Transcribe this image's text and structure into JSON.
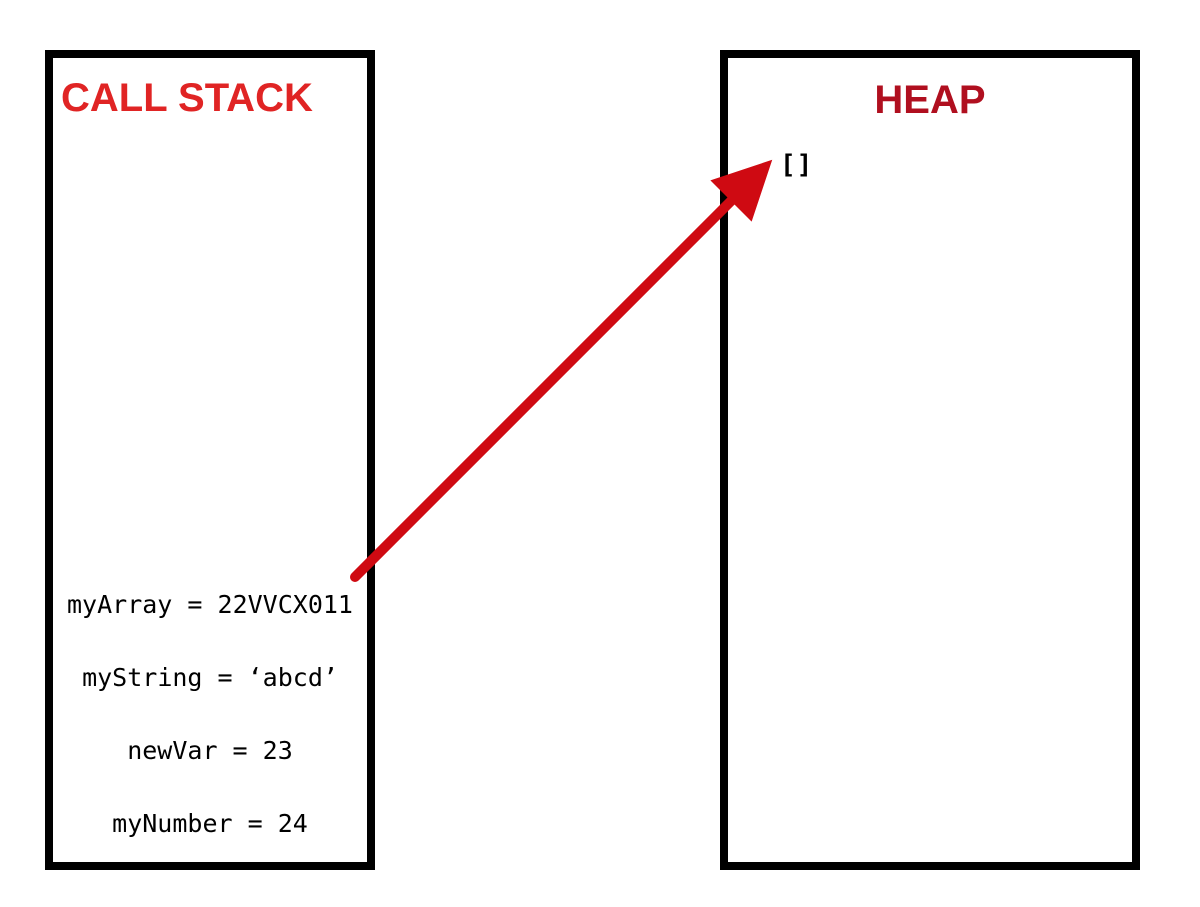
{
  "call_stack": {
    "title": "CALL STACK",
    "entries": [
      "myArray = 22VVCX011",
      "myString = ‘abcd’",
      "newVar = 23",
      "myNumber = 24"
    ]
  },
  "heap": {
    "title": "HEAP",
    "value": "[]"
  },
  "colors": {
    "call_stack_title": "#e02424",
    "heap_title": "#b00f1f",
    "arrow": "#cf0a12"
  }
}
